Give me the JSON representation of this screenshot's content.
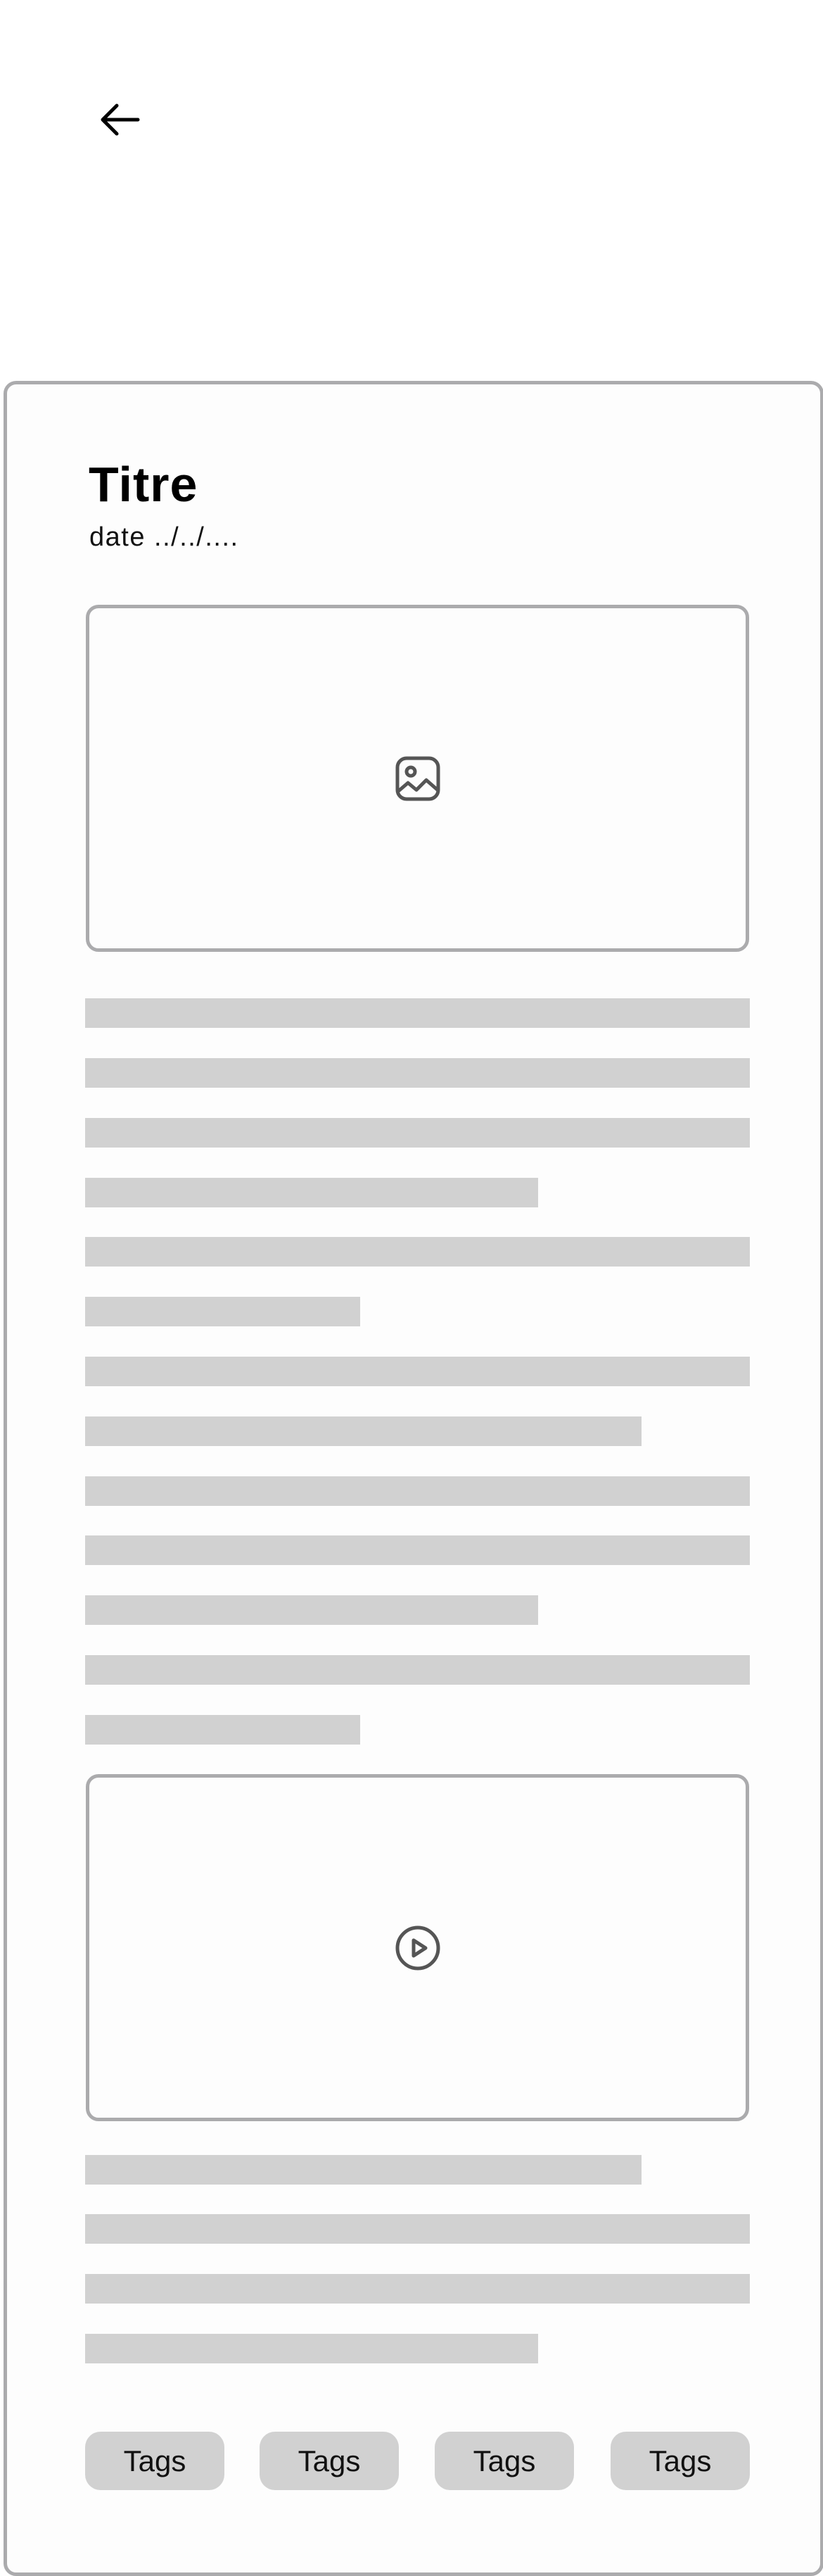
{
  "header": {
    "back_icon": "arrow-left-icon"
  },
  "article": {
    "title": "Titre",
    "date": "date ../../....",
    "image_placeholder_icon": "image-icon",
    "video_placeholder_icon": "play-circle-icon",
    "tags": [
      "Tags",
      "Tags",
      "Tags",
      "Tags"
    ]
  },
  "colors": {
    "card_border": "#ababad",
    "skeleton": "#d1d1d1",
    "tag_background": "#d1d1d1",
    "icon": "#555555"
  }
}
